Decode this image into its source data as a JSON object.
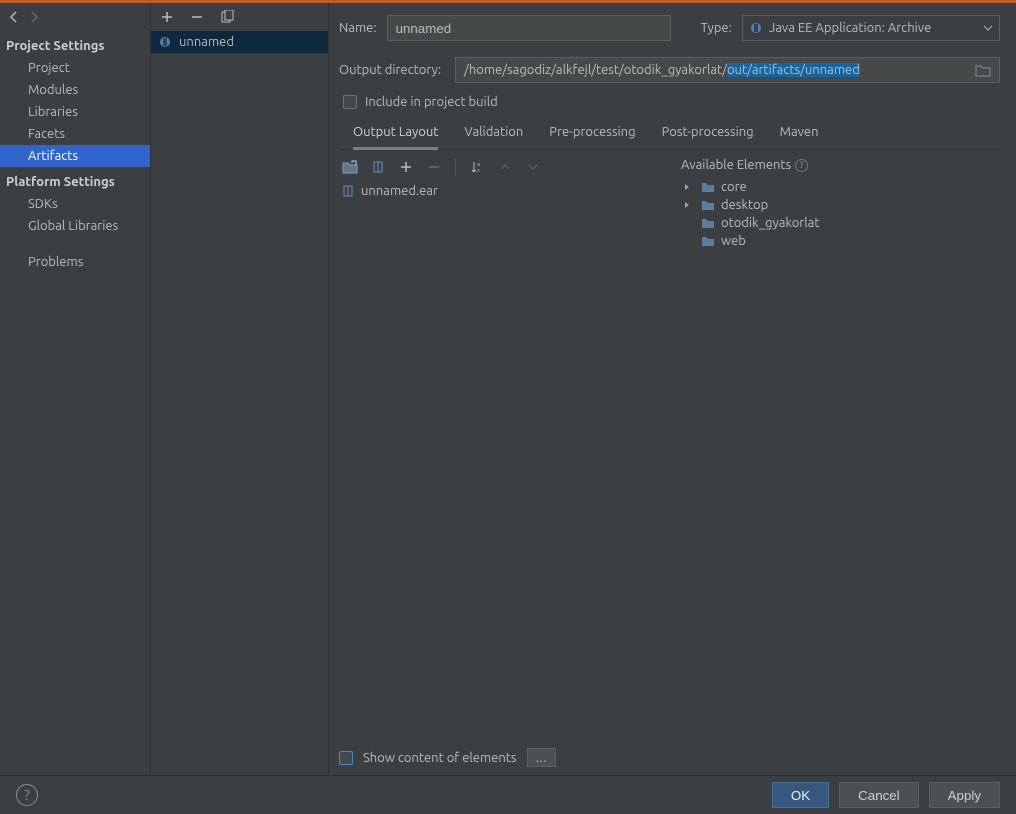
{
  "sidebar": {
    "heading_project": "Project Settings",
    "heading_platform": "Platform Settings",
    "items_project": [
      "Project",
      "Modules",
      "Libraries",
      "Facets",
      "Artifacts"
    ],
    "items_platform": [
      "SDKs",
      "Global Libraries"
    ],
    "problems": "Problems",
    "selected": "Artifacts"
  },
  "artifact_list": {
    "items": [
      {
        "name": "unnamed",
        "icon": "java-ee-icon"
      }
    ]
  },
  "form": {
    "name_label": "Name:",
    "name_value": "unnamed",
    "type_label": "Type:",
    "type_value": "Java EE Application: Archive",
    "outdir_label": "Output directory:",
    "outdir_prefix": "/home/sagodiz/alkfejl/test/otodik_gyakorlat/",
    "outdir_suffix": "out/artifacts/unnamed",
    "include_label": "Include in project build"
  },
  "tabs": [
    "Output Layout",
    "Validation",
    "Pre-processing",
    "Post-processing",
    "Maven"
  ],
  "active_tab": "Output Layout",
  "output_tree": [
    {
      "name": "unnamed.ear",
      "icon": "ear"
    }
  ],
  "available": {
    "header": "Available Elements",
    "items": [
      {
        "name": "core",
        "icon": "folder",
        "expandable": true
      },
      {
        "name": "desktop",
        "icon": "folder",
        "expandable": true
      },
      {
        "name": "otodik_gyakorlat",
        "icon": "folder",
        "expandable": false
      },
      {
        "name": "web",
        "icon": "folder",
        "expandable": false
      }
    ]
  },
  "bottom": {
    "show_content_label": "Show content of elements",
    "ellipsis": "..."
  },
  "footer": {
    "ok": "OK",
    "cancel": "Cancel",
    "apply": "Apply"
  }
}
